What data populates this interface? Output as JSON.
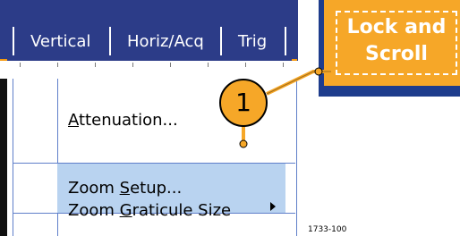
{
  "menubar": {
    "tabs": [
      {
        "label": "Vertical"
      },
      {
        "label": "Horiz/Acq"
      },
      {
        "label": "Trig"
      }
    ]
  },
  "dropdown": {
    "items": [
      {
        "label": "Attenuation...",
        "mnemonic_index": 0
      },
      {
        "label": "Zoom Setup...",
        "mnemonic_index": 5,
        "state": "highlighted"
      },
      {
        "label": "Zoom Graticule Size",
        "mnemonic_index": 5,
        "has_submenu": true
      }
    ]
  },
  "lock_button": {
    "line1": "Lock and",
    "line2": "Scroll"
  },
  "callout": {
    "number": "1"
  },
  "figure_id": "1733-100",
  "colors": {
    "menubar": "#2c3c88",
    "accent": "#f6a728",
    "highlight": "#b9d3f0",
    "menu_border": "#5f7fc9"
  }
}
